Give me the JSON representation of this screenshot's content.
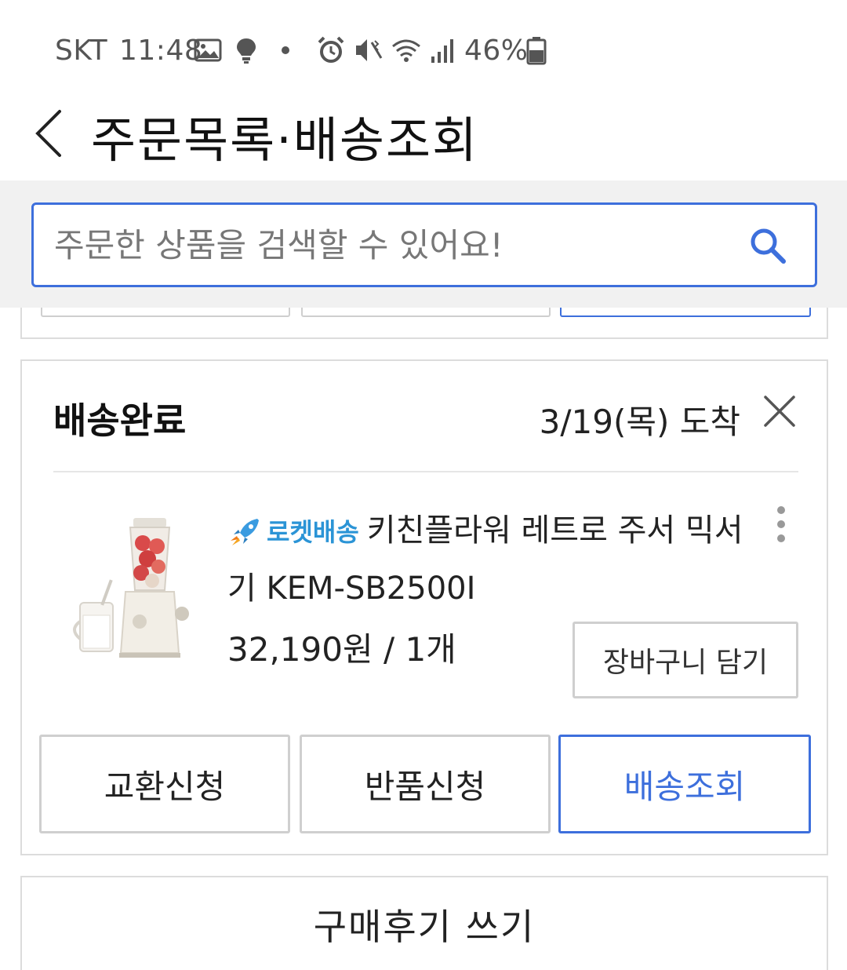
{
  "status_bar": {
    "carrier": "SKT",
    "time": "11:48",
    "battery": "46%",
    "icons": [
      "image-icon",
      "bulb-icon",
      "dot-icon",
      "alarm-icon",
      "vibrate-icon",
      "wifi-icon",
      "signal-icon",
      "battery-icon"
    ]
  },
  "header": {
    "title": "주문목록·배송조회",
    "back_icon": "chevron-left-icon"
  },
  "search": {
    "placeholder": "주문한 상품을 검색할 수 있어요!",
    "value": "",
    "icon": "search-icon"
  },
  "order": {
    "status": "배송완료",
    "arrival": "3/19(목) 도착",
    "product": {
      "badge": "로켓배송",
      "title": "키친플라워 레트로 주서 믹서기 KEM-SB2500I",
      "price_qty": "32,190원 / 1개",
      "cart_button": "장바구니 담기"
    },
    "actions": {
      "exchange": "교환신청",
      "return": "반품신청",
      "tracking": "배송조회"
    }
  },
  "review": {
    "button": "구매후기 쓰기"
  },
  "colors": {
    "accent": "#3d6fdc",
    "rocket": "#2b94d6",
    "border": "#cfcfcf",
    "search_bg": "#f1f1f1"
  }
}
